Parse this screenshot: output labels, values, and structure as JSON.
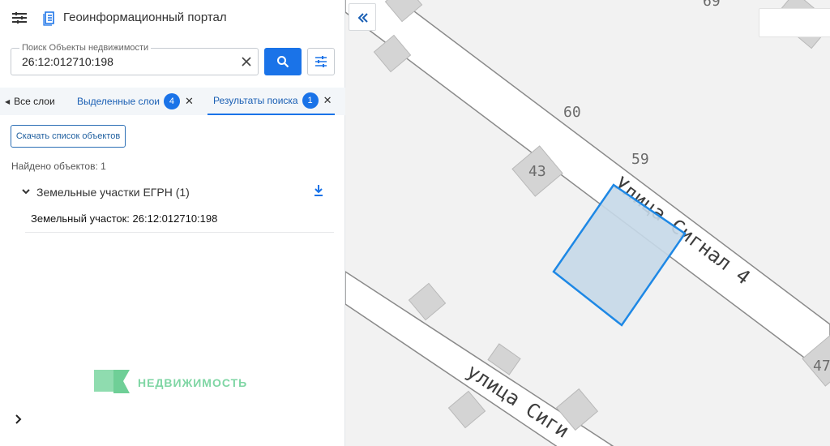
{
  "header": {
    "title": "Геоинформационный портал"
  },
  "search": {
    "label": "Поиск Объекты недвижимости",
    "value": "26:12:012710:198"
  },
  "tabs": [
    {
      "label": "Все слои"
    },
    {
      "label": "Выделенные слои",
      "badge": "4"
    },
    {
      "label": "Результаты поиска",
      "badge": "1"
    }
  ],
  "results": {
    "download_label": "Скачать список объектов",
    "found_text": "Найдено объектов: 1",
    "group_title": "Земельные участки ЕГРН (1)",
    "item_label": "Земельный участок: 26:12:012710:198"
  },
  "brand": {
    "text": "НЕДВИЖИМОСТЬ"
  },
  "map": {
    "street_1": "Улица Сигнал 4",
    "street_2": "улица Сиги",
    "house_numbers": [
      "69",
      "60",
      "59",
      "43",
      "47"
    ]
  },
  "colors": {
    "accent": "#1a73e8",
    "parcel_stroke": "#1e88e5",
    "parcel_fill": "#c5d8e8",
    "brand_green": "#7fd6a4"
  },
  "icons": {
    "menu": "menu-icon",
    "logo": "layers-logo-icon",
    "clear": "close-icon",
    "search": "search-icon",
    "filter": "sliders-icon",
    "download": "download-icon",
    "collapse": "double-chevron-left-icon"
  }
}
